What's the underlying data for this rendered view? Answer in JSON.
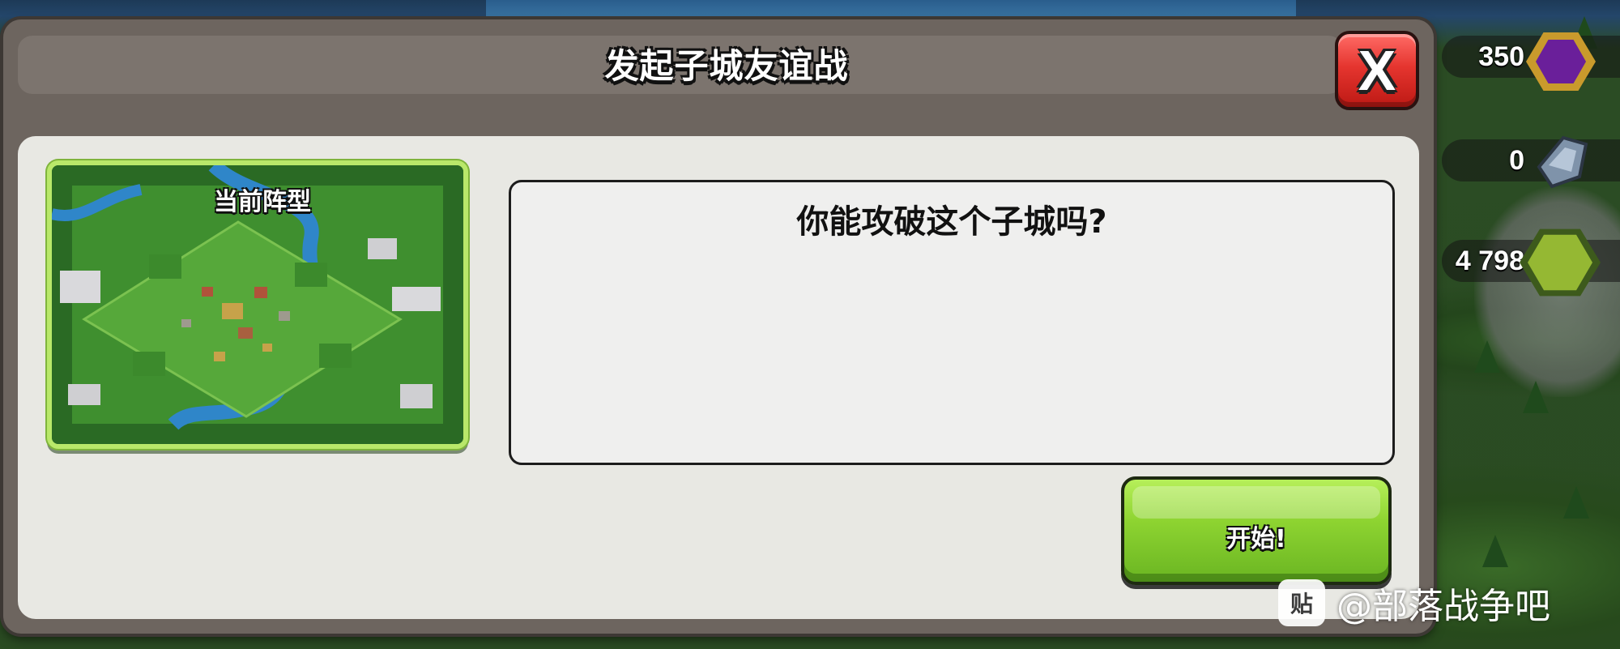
{
  "dialog": {
    "title": "发起子城友谊战",
    "close_label": "X",
    "preview_label": "当前阵型",
    "message": "你能攻破这个子城吗?",
    "start_label": "开始!"
  },
  "resources": {
    "elixir": "350",
    "ore": "0",
    "gems": "4 798"
  },
  "watermark": {
    "logo_text": "贴",
    "text": "@部落战争吧"
  },
  "colors": {
    "close_button": "#e5352f",
    "start_button": "#8ed431",
    "preview_border": "#b9e86a",
    "dialog_frame": "#6d655f",
    "content_panel": "#e8e8e3"
  },
  "icons": [
    "dark-elixir-icon",
    "ore-icon",
    "gem-icon",
    "tieba-logo-icon"
  ]
}
